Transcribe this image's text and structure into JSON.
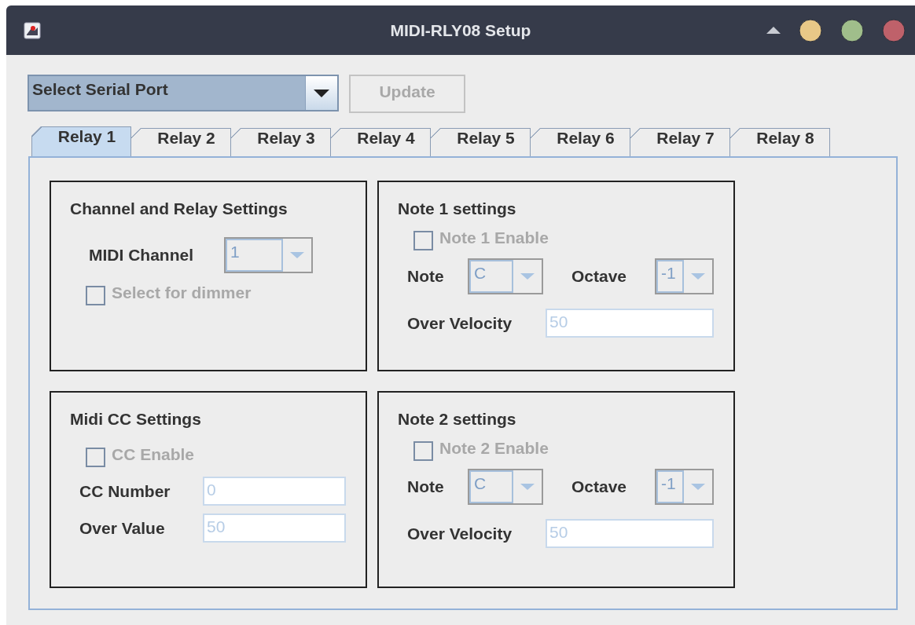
{
  "window": {
    "title": "MIDI-RLY08 Setup"
  },
  "serial_port": {
    "value": "Select Serial Port"
  },
  "update_button": {
    "label": "Update",
    "disabled": true
  },
  "tabs": [
    {
      "label": "Relay 1",
      "selected": true
    },
    {
      "label": "Relay 2",
      "selected": false
    },
    {
      "label": "Relay 3",
      "selected": false
    },
    {
      "label": "Relay 4",
      "selected": false
    },
    {
      "label": "Relay 5",
      "selected": false
    },
    {
      "label": "Relay 6",
      "selected": false
    },
    {
      "label": "Relay 7",
      "selected": false
    },
    {
      "label": "Relay 8",
      "selected": false
    }
  ],
  "panels": [
    {
      "kind": "channel",
      "title": "Channel and Relay Settings",
      "rows": [
        [
          {
            "kind": "combo",
            "label": "MIDI Channel",
            "value": "1",
            "disabled": true
          }
        ],
        [
          {
            "kind": "checkbox",
            "label": "Select for dimmer",
            "checked": false,
            "disabled": true
          }
        ]
      ]
    },
    {
      "kind": "note",
      "title": "Note 1 settings",
      "rows": [
        [
          {
            "kind": "checkbox",
            "label": "Note 1 Enable",
            "checked": false,
            "disabled": true
          }
        ],
        [
          {
            "kind": "combo",
            "label": "Note",
            "value": "C",
            "disabled": true
          },
          {
            "kind": "combo",
            "label": "Octave",
            "value": "-1",
            "disabled": true
          }
        ],
        [
          {
            "kind": "text",
            "label": "Over Velocity",
            "value": "50",
            "disabled": true
          }
        ]
      ]
    },
    {
      "kind": "cc",
      "title": "Midi CC Settings",
      "rows": [
        [
          {
            "kind": "checkbox",
            "label": "CC Enable",
            "checked": false,
            "disabled": true
          }
        ],
        [
          {
            "kind": "text",
            "label": "CC Number",
            "value": "0",
            "disabled": true
          }
        ],
        [
          {
            "kind": "text",
            "label": "Over Value",
            "value": "50",
            "disabled": true
          }
        ]
      ]
    },
    {
      "kind": "note",
      "title": "Note 2 settings",
      "rows": [
        [
          {
            "kind": "checkbox",
            "label": "Note 2 Enable",
            "checked": false,
            "disabled": true
          }
        ],
        [
          {
            "kind": "combo",
            "label": "Note",
            "value": "C",
            "disabled": true
          },
          {
            "kind": "combo",
            "label": "Octave",
            "value": "-1",
            "disabled": true
          }
        ],
        [
          {
            "kind": "text",
            "label": "Over Velocity",
            "value": "50",
            "disabled": true
          }
        ]
      ]
    }
  ]
}
